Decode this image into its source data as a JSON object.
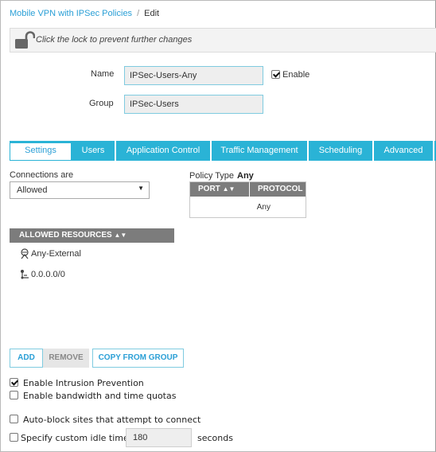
{
  "breadcrumb": {
    "parent": "Mobile VPN with IPSec Policies",
    "separator": "/",
    "current": "Edit"
  },
  "lockbar": {
    "message": "Click the lock to prevent further changes"
  },
  "form": {
    "name_label": "Name",
    "name_value": "IPSec-Users-Any",
    "enable_label": "Enable",
    "enable_checked": true,
    "group_label": "Group",
    "group_value": "IPSec-Users"
  },
  "tabs": [
    {
      "label": "Settings",
      "active": true
    },
    {
      "label": "Users",
      "active": false
    },
    {
      "label": "Application Control",
      "active": false
    },
    {
      "label": "Traffic Management",
      "active": false
    },
    {
      "label": "Scheduling",
      "active": false
    },
    {
      "label": "Advanced",
      "active": false
    }
  ],
  "settings": {
    "connections_label": "Connections are",
    "connections_value": "Allowed",
    "policy_type_label": "Policy Type",
    "policy_type_value": "Any",
    "port_header": "PORT",
    "protocol_header": "PROTOCOL",
    "protocol_value": "Any",
    "allowed_resources_header": "ALLOWED RESOURCES",
    "resources": [
      "Any-External",
      "0.0.0.0/0"
    ]
  },
  "buttons": {
    "add": "ADD",
    "remove": "REMOVE",
    "copy_from_group": "COPY FROM GROUP"
  },
  "options": {
    "intrusion_prevention": {
      "label": "Enable Intrusion Prevention",
      "checked": true
    },
    "bandwidth_quotas": {
      "label": "Enable bandwidth and time quotas",
      "checked": false
    },
    "auto_block": {
      "label": "Auto-block sites that attempt to connect",
      "checked": false
    },
    "idle_timeout": {
      "label": "Specify custom idle timeout",
      "checked": false,
      "value": "180",
      "unit": "seconds"
    }
  },
  "colors": {
    "accent": "#2ab3d6",
    "link": "#2a9fd6",
    "table_header": "#7c7c7c"
  }
}
